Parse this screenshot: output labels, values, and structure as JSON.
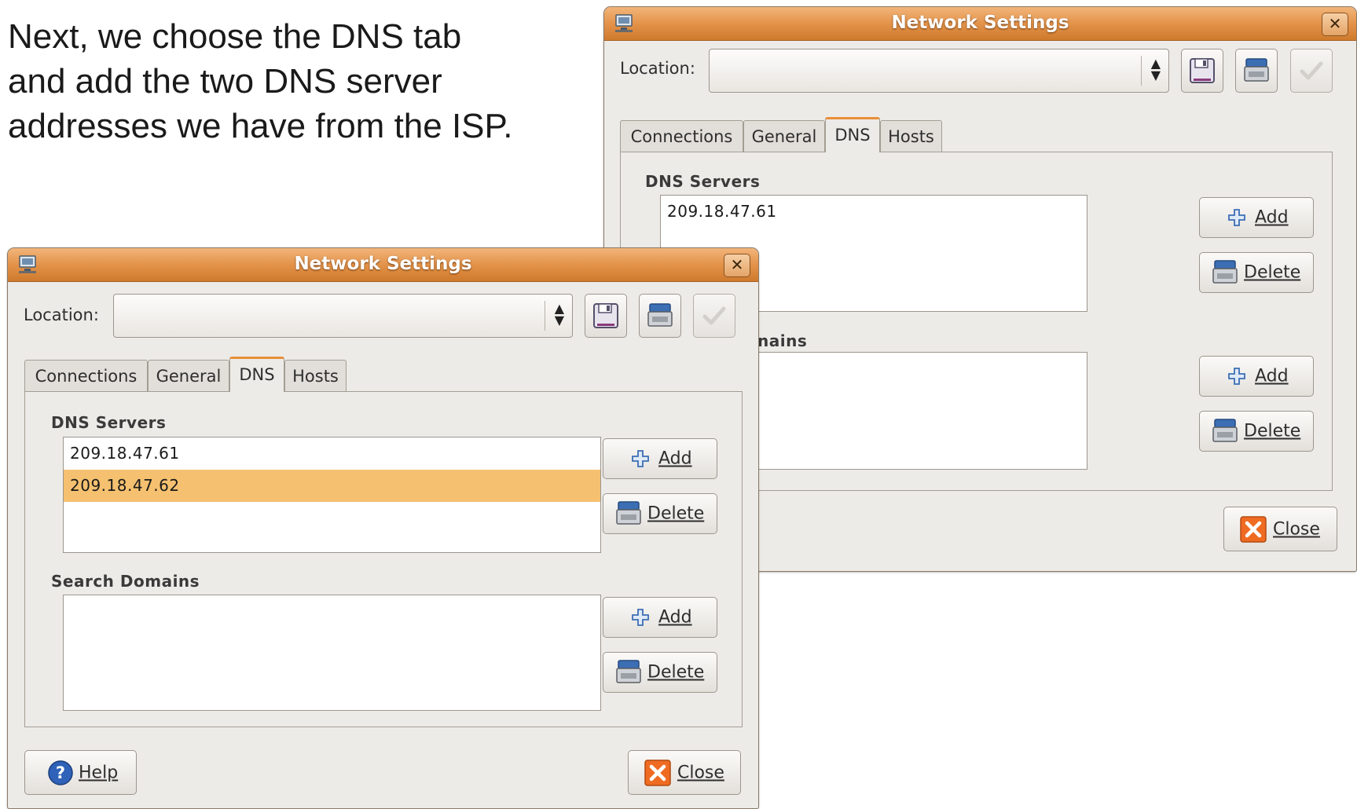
{
  "caption": "Next, we choose the DNS tab and add the two DNS server addresses we have from the ISP.",
  "back_window": {
    "title": "Network Settings",
    "location_label": "Location:",
    "location_value": "",
    "tabs": [
      "Connections",
      "General",
      "DNS",
      "Hosts"
    ],
    "active_tab": "DNS",
    "dns_servers_label": "DNS Servers",
    "dns_servers": [
      "209.18.47.61"
    ],
    "search_domains_label_partial": "nains",
    "add_label": "Add",
    "delete_label": "Delete",
    "close_label": "Close"
  },
  "front_window": {
    "title": "Network Settings",
    "location_label": "Location:",
    "location_value": "",
    "tabs": [
      "Connections",
      "General",
      "DNS",
      "Hosts"
    ],
    "active_tab": "DNS",
    "dns_servers_label": "DNS Servers",
    "dns_servers": [
      "209.18.47.61",
      "209.18.47.62"
    ],
    "selected_server": "209.18.47.62",
    "search_domains_label": "Search Domains",
    "search_domains": [],
    "add_label": "Add",
    "delete_label": "Delete",
    "help_label": "Help",
    "close_label": "Close"
  },
  "icons": [
    "network-icon",
    "close-icon",
    "save-icon",
    "delete-location-icon",
    "apply-icon",
    "add-icon",
    "delete-icon",
    "help-icon"
  ],
  "colors": {
    "titlebar": "#e3934a",
    "selection": "#f5c170",
    "active_tab_accent": "#e88f39",
    "close_icon": "#ef6b22",
    "help_icon": "#2f62b8"
  }
}
